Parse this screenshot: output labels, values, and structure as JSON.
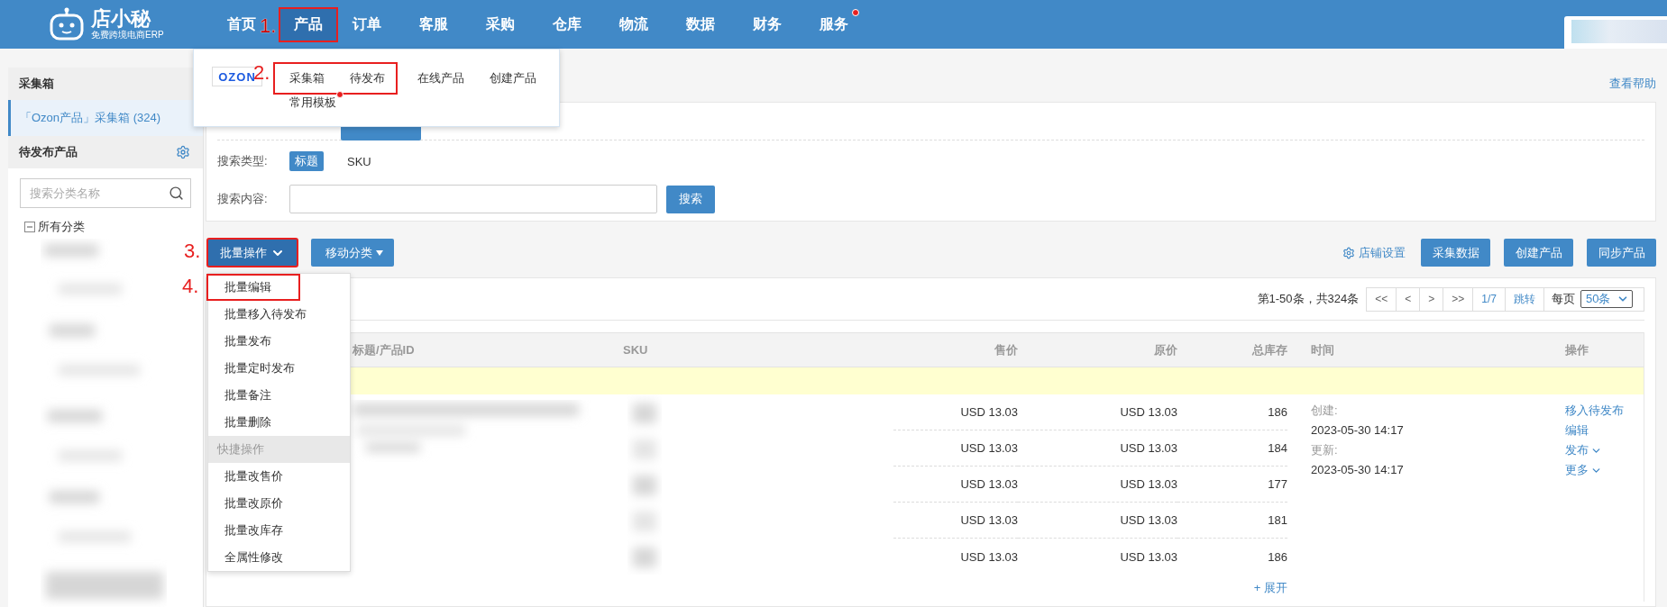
{
  "logo": {
    "name": "店小秘",
    "tagline": "免费跨境电商ERP"
  },
  "nav": [
    {
      "label": "首页",
      "selected": false,
      "badge_dot": false
    },
    {
      "label": "产品",
      "selected": true,
      "badge_dot": false,
      "annotation": "1."
    },
    {
      "label": "订单",
      "selected": false,
      "badge_dot": false
    },
    {
      "label": "客服",
      "selected": false,
      "badge_dot": false
    },
    {
      "label": "采购",
      "selected": false,
      "badge_dot": false
    },
    {
      "label": "仓库",
      "selected": false,
      "badge_dot": false
    },
    {
      "label": "物流",
      "selected": false,
      "badge_dot": false
    },
    {
      "label": "数据",
      "selected": false,
      "badge_dot": false
    },
    {
      "label": "财务",
      "selected": false,
      "badge_dot": false
    },
    {
      "label": "服务",
      "selected": false,
      "badge_dot": true
    }
  ],
  "product_menu": {
    "brand": "OZON",
    "groups": [
      {
        "annotation": "2.",
        "items": [
          {
            "label": "采集箱",
            "badge_dot": false
          },
          {
            "label": "待发布",
            "badge_dot": false
          }
        ]
      },
      {
        "items": [
          {
            "label": "在线产品",
            "badge_dot": false
          },
          {
            "label": "创建产品",
            "badge_dot": false
          }
        ]
      }
    ],
    "second_row": [
      {
        "label": "常用模板",
        "badge_dot": true
      }
    ]
  },
  "sidebar": {
    "inbox_title": "采集箱",
    "inbox_items": [
      {
        "label": "「Ozon产品」采集箱 (324)",
        "selected": true
      }
    ],
    "pending_title": "待发布产品",
    "search_placeholder": "搜索分类名称",
    "tree": [
      {
        "label": "所有分类",
        "expanded": true
      }
    ]
  },
  "help_link": "查看帮助",
  "search": {
    "type_label": "搜索类型:",
    "types": [
      {
        "label": "标题",
        "selected": true
      },
      {
        "label": "SKU",
        "selected": false
      }
    ],
    "content_label": "搜索内容:",
    "button": "搜索"
  },
  "toolbar": {
    "batch_button": {
      "label": "批量操作",
      "expanded": true,
      "annotation": "3."
    },
    "move_button": "移动分类",
    "store_settings": "店铺设置",
    "actions": [
      "采集数据",
      "创建产品",
      "同步产品"
    ]
  },
  "batch_menu": [
    {
      "kind": "item",
      "label": "批量编辑",
      "annotation": "4."
    },
    {
      "kind": "item",
      "label": "批量移入待发布"
    },
    {
      "kind": "item",
      "label": "批量发布"
    },
    {
      "kind": "item",
      "label": "批量定时发布"
    },
    {
      "kind": "item",
      "label": "批量备注"
    },
    {
      "kind": "item",
      "label": "批量删除"
    },
    {
      "kind": "header",
      "label": "快捷操作"
    },
    {
      "kind": "item",
      "label": "批量改售价"
    },
    {
      "kind": "item",
      "label": "批量改原价"
    },
    {
      "kind": "item",
      "label": "批量改库存"
    },
    {
      "kind": "item",
      "label": "全属性修改"
    }
  ],
  "pagination": {
    "summary": "第1-50条，共324条",
    "buttons": [
      "<<",
      "<",
      ">",
      ">>"
    ],
    "page": "1/7",
    "jump": "跳转",
    "per_page_label": "每页",
    "per_page": "50条"
  },
  "table": {
    "columns": [
      "标题/产品ID",
      "SKU",
      "售价",
      "原价",
      "总库存",
      "时间",
      "操作"
    ],
    "product": {
      "variants": [
        {
          "price": "USD 13.03",
          "original_price": "USD 13.03",
          "stock": "186"
        },
        {
          "price": "USD 13.03",
          "original_price": "USD 13.03",
          "stock": "184"
        },
        {
          "price": "USD 13.03",
          "original_price": "USD 13.03",
          "stock": "177"
        },
        {
          "price": "USD 13.03",
          "original_price": "USD 13.03",
          "stock": "181"
        },
        {
          "price": "USD 13.03",
          "original_price": "USD 13.03",
          "stock": "186"
        }
      ],
      "times": [
        {
          "label": "创建:",
          "value": "2023-05-30 14:17"
        },
        {
          "label": "更新:",
          "value": "2023-05-30 14:17"
        }
      ],
      "actions": [
        {
          "label": "移入待发布",
          "dropdown": false
        },
        {
          "label": "编辑",
          "dropdown": false
        },
        {
          "label": "发布",
          "dropdown": true
        },
        {
          "label": "更多",
          "dropdown": true
        }
      ],
      "expand": "+ 展开"
    }
  }
}
